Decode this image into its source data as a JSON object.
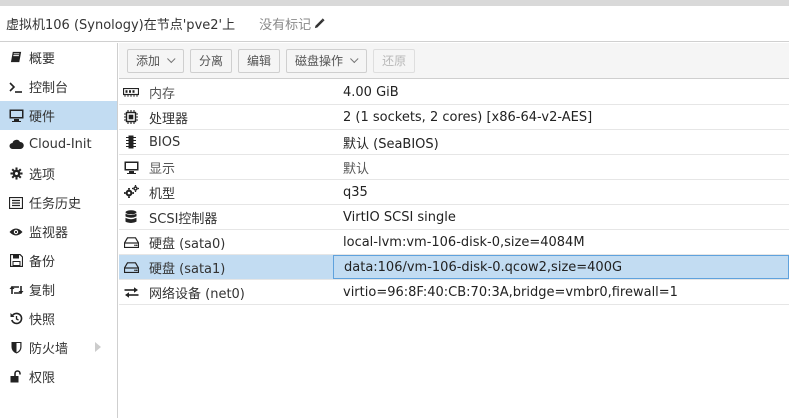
{
  "header": {
    "title": "虚拟机106 (Synology)在节点'pve2'上",
    "tags_label": "没有标记"
  },
  "sidebar": {
    "items": [
      {
        "label": "概要",
        "icon": "book-icon"
      },
      {
        "label": "控制台",
        "icon": "terminal-icon"
      },
      {
        "label": "硬件",
        "icon": "desktop-icon",
        "active": true
      },
      {
        "label": "Cloud-Init",
        "icon": "cloud-icon"
      },
      {
        "label": "选项",
        "icon": "gear-icon"
      },
      {
        "label": "任务历史",
        "icon": "list-icon"
      },
      {
        "label": "监视器",
        "icon": "eye-icon"
      },
      {
        "label": "备份",
        "icon": "floppy-icon"
      },
      {
        "label": "复制",
        "icon": "retweet-icon"
      },
      {
        "label": "快照",
        "icon": "history-icon"
      },
      {
        "label": "防火墙",
        "icon": "shield-icon",
        "has_submenu": true
      },
      {
        "label": "权限",
        "icon": "unlock-icon"
      }
    ]
  },
  "toolbar": {
    "add_label": "添加",
    "detach_label": "分离",
    "edit_label": "编辑",
    "disk_action_label": "磁盘操作",
    "revert_label": "还原"
  },
  "hardware": {
    "rows": [
      {
        "key": "内存",
        "value": "4.00 GiB",
        "icon": "memory-icon",
        "muted_key": true
      },
      {
        "key": "处理器",
        "value": "2 (1 sockets, 2 cores) [x86-64-v2-AES]",
        "icon": "cpu-icon"
      },
      {
        "key": "BIOS",
        "value": "默认 (SeaBIOS)",
        "icon": "bios-chip-icon"
      },
      {
        "key": "显示",
        "value": "默认",
        "icon": "monitor-icon",
        "muted_key": true
      },
      {
        "key": "机型",
        "value": "q35",
        "icon": "cogs-icon"
      },
      {
        "key": "SCSI控制器",
        "value": "VirtIO SCSI single",
        "icon": "database-icon"
      },
      {
        "key": "硬盘 (sata0)",
        "value": "local-lvm:vm-106-disk-0,size=4084M",
        "icon": "hdd-icon"
      },
      {
        "key": "硬盘 (sata1)",
        "value": "data:106/vm-106-disk-0.qcow2,size=400G",
        "icon": "hdd-icon",
        "selected": true
      },
      {
        "key": "网络设备 (net0)",
        "value": "virtio=96:8F:40:CB:70:3A,bridge=vmbr0,firewall=1",
        "icon": "exchange-icon"
      }
    ]
  },
  "colors": {
    "selection": "#c2dcf2",
    "selection_border": "#5fa2dd",
    "toolbar_bg": "#f5f5f5"
  }
}
